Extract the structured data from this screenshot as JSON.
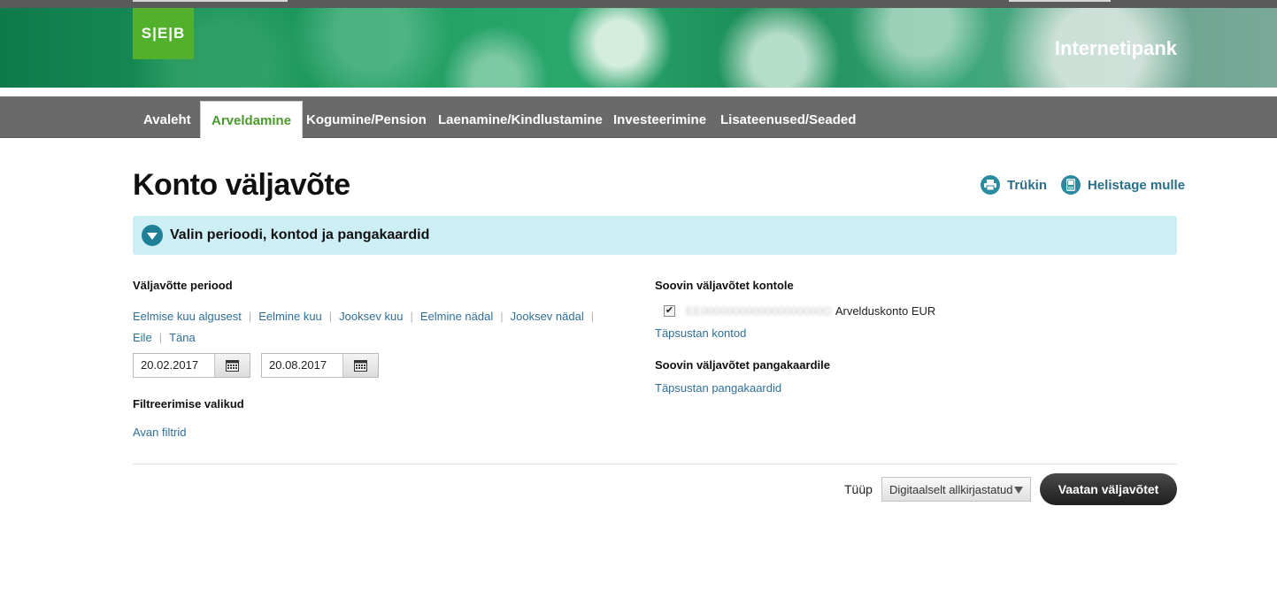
{
  "header": {
    "logo_text": "S|E|B",
    "title": "Internetipank"
  },
  "nav": {
    "items": [
      {
        "label": "Avaleht"
      },
      {
        "label": "Arveldamine"
      },
      {
        "label": "Kogumine/Pension"
      },
      {
        "label": "Laenamine/Kindlustamine"
      },
      {
        "label": "Investeerimine"
      },
      {
        "label": "Lisateenused/Seaded"
      }
    ],
    "active_index": 1
  },
  "page": {
    "title": "Konto väljavõte",
    "print_label": "Trükin",
    "call_label": "Helistage mulle"
  },
  "accordion": {
    "label": "Valin perioodi, kontod ja pangakaardid"
  },
  "period": {
    "label": "Väljavõtte periood",
    "links": [
      "Eelmise kuu algusest",
      "Eelmine kuu",
      "Jooksev kuu",
      "Eelmine nädal",
      "Jooksev nädal",
      "Eile",
      "Täna"
    ],
    "separator": "|",
    "start_date": "20.02.2017",
    "end_date": "20.08.2017"
  },
  "filters": {
    "label": "Filtreerimise valikud",
    "open_link": "Avan filtrid"
  },
  "accounts": {
    "label": "Soovin väljavõtet kontole",
    "masked_number": "EE0000000000000000000O",
    "account_name": "Arvelduskonto EUR",
    "checked": true,
    "refine_link": "Täpsustan kontod"
  },
  "cards": {
    "label": "Soovin väljavõtet pangakaardile",
    "refine_link": "Täpsustan pangakaardid"
  },
  "footer": {
    "type_label": "Tüüp",
    "type_value": "Digitaalselt allkirjastatud",
    "submit_label": "Vaatan väljavõtet"
  },
  "colors": {
    "brand_green": "#52b02c",
    "link_blue": "#2e6f9a",
    "accordion_bg": "#cdeef5",
    "nav_bg": "#6a6a6a"
  }
}
